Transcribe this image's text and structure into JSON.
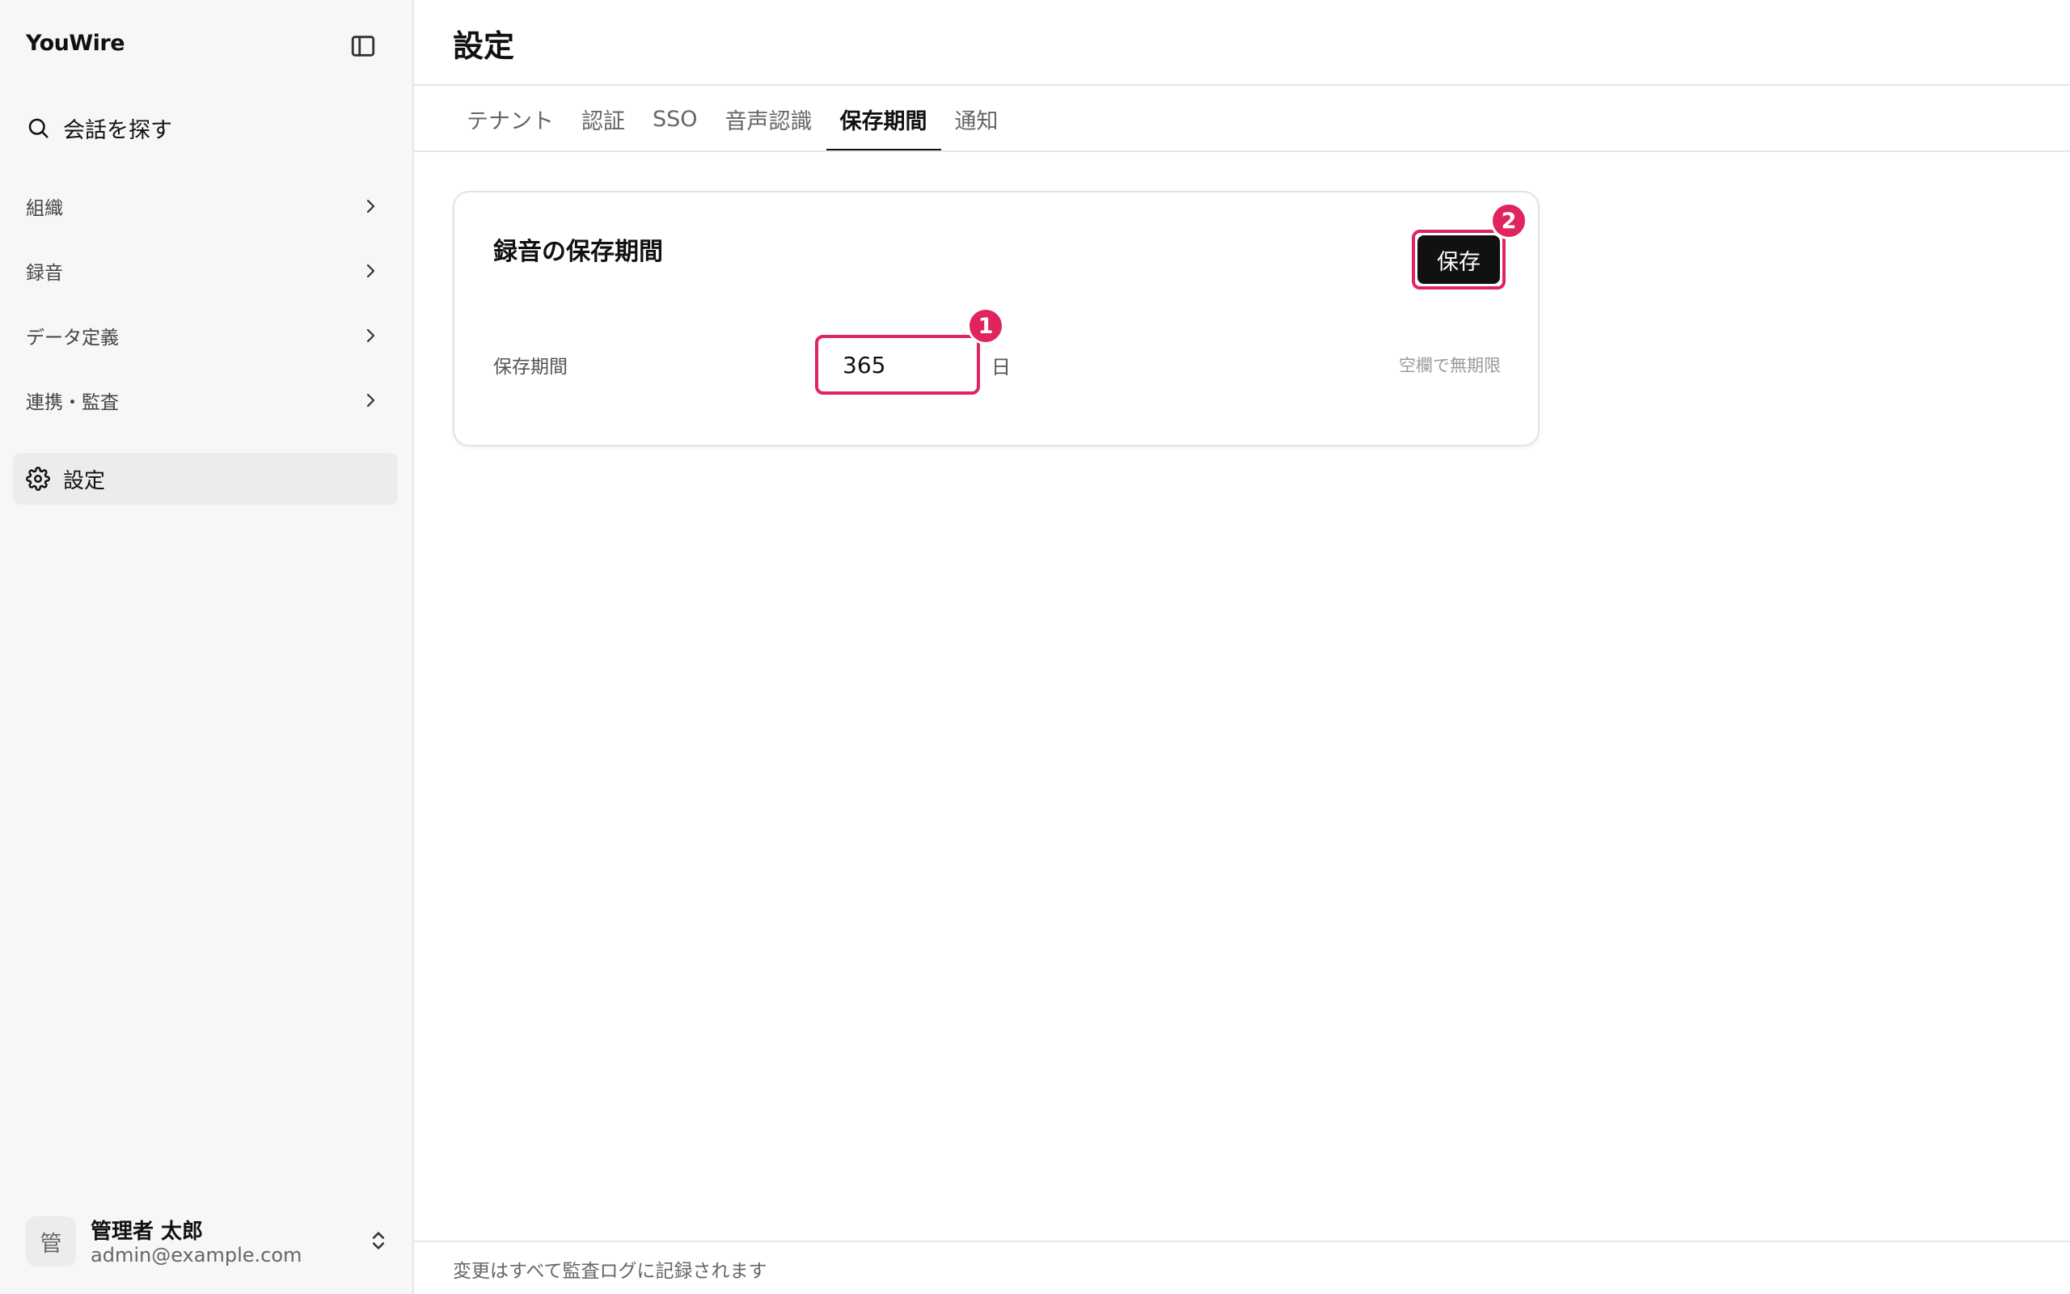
{
  "app": {
    "brand": "YouWire"
  },
  "sidebar": {
    "search_label": "会話を探す",
    "items": [
      {
        "label": "組織"
      },
      {
        "label": "録音"
      },
      {
        "label": "データ定義"
      },
      {
        "label": "連携・監査"
      }
    ],
    "settings_label": "設定",
    "user": {
      "avatar_char": "管",
      "name": "管理者 太郎",
      "email": "admin@example.com"
    }
  },
  "page": {
    "title": "設定"
  },
  "tabs": [
    {
      "label": "テナント",
      "active": false
    },
    {
      "label": "認証",
      "active": false
    },
    {
      "label": "SSO",
      "active": false
    },
    {
      "label": "音声認識",
      "active": false
    },
    {
      "label": "保存期間",
      "active": true
    },
    {
      "label": "通知",
      "active": false
    }
  ],
  "card": {
    "title": "録音の保存期間",
    "save_label": "保存",
    "field_label": "保存期間",
    "field_value": "365",
    "unit": "日",
    "hint": "空欄で無期限"
  },
  "annotations": {
    "badge_1": "1",
    "badge_2": "2",
    "color": "#e0245e"
  },
  "footer": {
    "text": "変更はすべて監査ログに記録されます"
  }
}
